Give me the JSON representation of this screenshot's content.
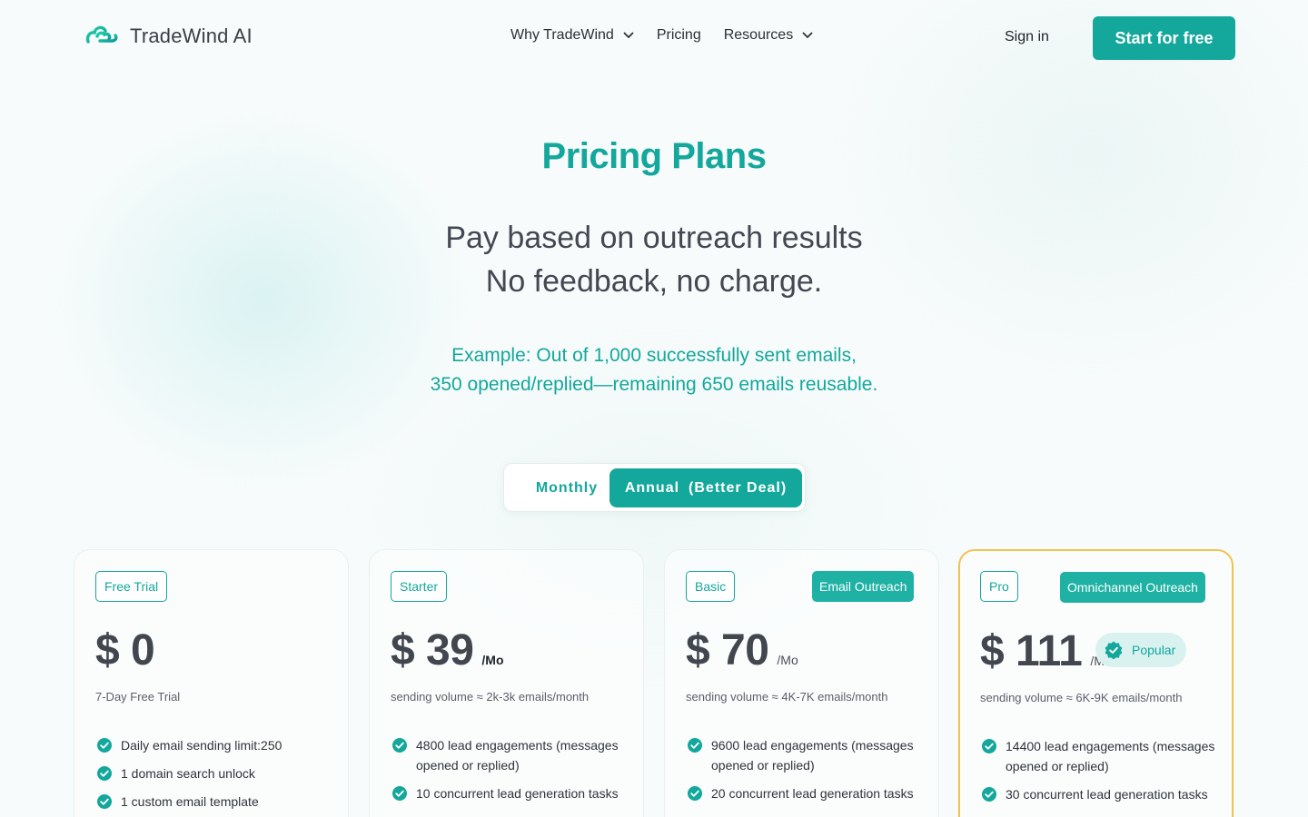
{
  "brand": {
    "name": "TradeWind AI",
    "logo_icon": "cloud-wind-icon",
    "accent": "#14a79c"
  },
  "nav": {
    "why": "Why TradeWind",
    "pricing": "Pricing",
    "resources": "Resources",
    "signin": "Sign in",
    "cta": "Start for free"
  },
  "hero": {
    "title": "Pricing Plans",
    "subtitle_line1": "Pay based on outreach results",
    "subtitle_line2": "No feedback, no charge.",
    "example_line1": "Example: Out of 1,000 successfully sent emails,",
    "example_line2": "350 opened/replied—remaining 650 emails reusable."
  },
  "billing_toggle": {
    "monthly": "Monthly",
    "annual": "Annual",
    "annual_note": "(Better Deal)",
    "selected": "Annual"
  },
  "plans": [
    {
      "tier": "Free Trial",
      "price": "$ 0",
      "volume": "7-Day Free Trial",
      "features": [
        "Daily email sending limit:250",
        "1 domain search unlock",
        "1 custom email template"
      ]
    },
    {
      "tier": "Starter",
      "price": "$ 39",
      "per": "/Mo",
      "volume": "sending volume ≈ 2k-3k emails/month",
      "features": [
        "4800 lead engagements (messages opened or replied)",
        "10 concurrent lead generation tasks"
      ]
    },
    {
      "tier": "Basic",
      "tag": "Email Outreach",
      "price": "$ 70",
      "per": "/Mo",
      "volume": "sending volume ≈ 4K-7K emails/month",
      "features": [
        "9600 lead engagements (messages opened or replied)",
        "20 concurrent lead generation tasks"
      ]
    },
    {
      "tier": "Pro",
      "tag": "Omnichannel Outreach",
      "price": "$ 111",
      "per": "/Mo",
      "popular": "Popular",
      "volume": "sending volume ≈ 6K-9K emails/month",
      "features": [
        "14400 lead engagements (messages opened or replied)",
        "30 concurrent lead generation tasks"
      ]
    }
  ]
}
